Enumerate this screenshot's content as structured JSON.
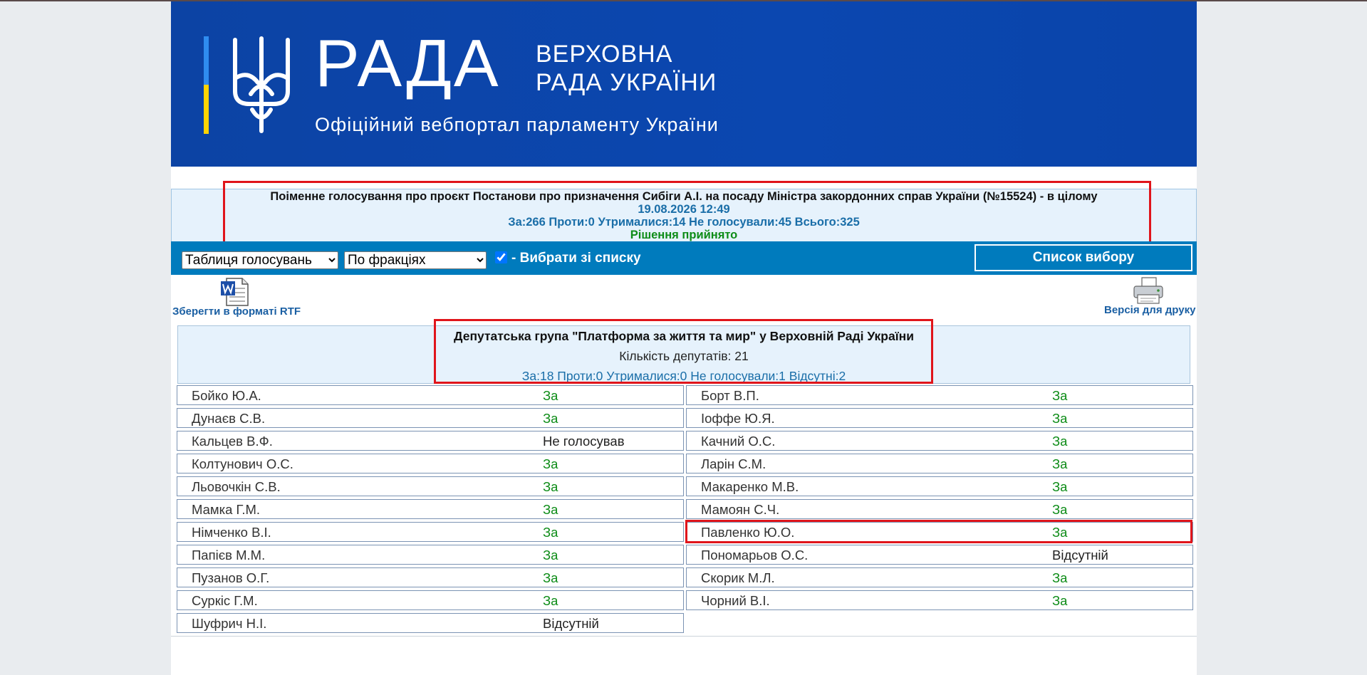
{
  "header": {
    "logo_text": "РАДА",
    "subtitle_line1": "ВЕРХОВНА",
    "subtitle_line2": "РАДА УКРАЇНИ",
    "portal_text": "Офіційний вебпортал парламенту України",
    "colors": {
      "background": "#0c43a4",
      "flag_blue": "#2f8cf0",
      "flag_yellow": "#ffd400"
    }
  },
  "vote": {
    "title": "Поіменне голосування про проєкт Постанови про призначення Сибіги А.І. на посаду Міністра закордонних справ України (№15524) - в цілому",
    "datetime": "19.08.2026 12:49",
    "summary": "За:266 Проти:0 Утрималися:14 Не голосували:45 Всього:325",
    "result": "Рішення прийнято"
  },
  "toolbar": {
    "view_select": {
      "selected": "Таблиця голосувань"
    },
    "group_select": {
      "selected": "По фракціях"
    },
    "checkbox_checked": true,
    "checkbox_label": "- Вибрати зі списку",
    "list_button": "Список вибору",
    "color": "#007bbd"
  },
  "actions": {
    "save_rtf": "Зберегти в форматі RTF",
    "print_version": "Версія для друку"
  },
  "faction": {
    "name": "Депутатська група \"Платформа за життя та мир\" у Верховній Раді України",
    "count": "Кількість депутатів: 21",
    "stats": "За:18 Проти:0 Утрималися:0 Не голосували:1 Відсутні:2"
  },
  "deputies_left": [
    {
      "name": "Бойко Ю.А.",
      "vote": "За"
    },
    {
      "name": "Дунаєв С.В.",
      "vote": "За"
    },
    {
      "name": "Кальцев В.Ф.",
      "vote": "Не голосував"
    },
    {
      "name": "Колтунович О.С.",
      "vote": "За"
    },
    {
      "name": "Льовочкін С.В.",
      "vote": "За"
    },
    {
      "name": "Мамка Г.М.",
      "vote": "За"
    },
    {
      "name": "Німченко В.І.",
      "vote": "За"
    },
    {
      "name": "Папієв М.М.",
      "vote": "За"
    },
    {
      "name": "Пузанов О.Г.",
      "vote": "За"
    },
    {
      "name": "Суркіс Г.М.",
      "vote": "За"
    },
    {
      "name": "Шуфрич Н.І.",
      "vote": "Відсутній"
    }
  ],
  "deputies_right": [
    {
      "name": "Борт В.П.",
      "vote": "За"
    },
    {
      "name": "Іоффе Ю.Я.",
      "vote": "За"
    },
    {
      "name": "Качний О.С.",
      "vote": "За"
    },
    {
      "name": "Ларін С.М.",
      "vote": "За"
    },
    {
      "name": "Макаренко М.В.",
      "vote": "За"
    },
    {
      "name": "Мамоян С.Ч.",
      "vote": "За"
    },
    {
      "name": "Павленко Ю.О.",
      "vote": "За"
    },
    {
      "name": "Пономарьов О.С.",
      "vote": "Відсутній"
    },
    {
      "name": "Скорик М.Л.",
      "vote": "За"
    },
    {
      "name": "Чорний В.І.",
      "vote": "За"
    }
  ],
  "colors": {
    "vote_for": "#0d8c17",
    "highlight_box": "#e0151b",
    "link": "#1a5fa3"
  }
}
